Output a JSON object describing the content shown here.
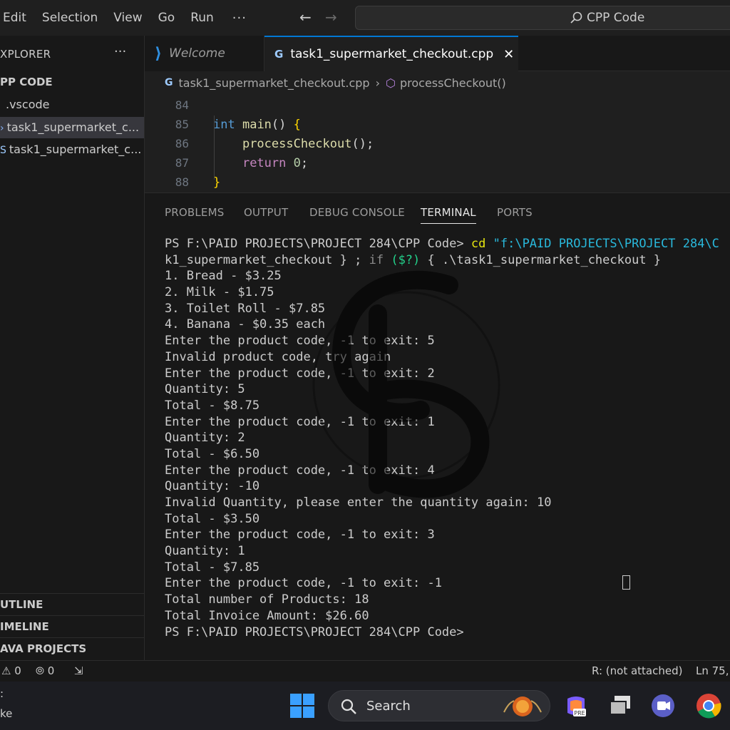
{
  "menubar": {
    "items": [
      "Edit",
      "Selection",
      "View",
      "Go",
      "Run"
    ],
    "more": "···",
    "search_placeholder": "CPP Code"
  },
  "sidebar": {
    "explorer_title": "XPLORER",
    "explorer_more": "···",
    "folder_title": "PP CODE",
    "items": [
      {
        "label": ".vscode"
      },
      {
        "label": "task1_supermarket_c...",
        "prefix": "›"
      },
      {
        "label": "task1_supermarket_c...",
        "prefix": "S"
      }
    ],
    "sections": [
      "UTLINE",
      "IMELINE",
      "AVA PROJECTS"
    ]
  },
  "tabs": {
    "welcome": "Welcome",
    "active": "task1_supermarket_checkout.cpp",
    "close": "✕"
  },
  "breadcrumb": {
    "file": "task1_supermarket_checkout.cpp",
    "symbol": "processCheckout()"
  },
  "editor": {
    "line_numbers": [
      "84",
      "85",
      "86",
      "87",
      "88"
    ],
    "lines": [
      "",
      "int main() {",
      "    processCheckout();",
      "    return 0;",
      "}"
    ]
  },
  "panel": {
    "tabs": [
      "PROBLEMS",
      "OUTPUT",
      "DEBUG CONSOLE",
      "TERMINAL",
      "PORTS"
    ],
    "active_tab": "TERMINAL"
  },
  "terminal": {
    "prompt": "PS F:\\PAID PROJECTS\\PROJECT 284\\CPP Code>",
    "command_cd": "cd",
    "command_path": "\"f:\\PAID PROJECTS\\PROJECT 284\\C",
    "line2_a": "k1_supermarket_checkout } ;",
    "line2_if": "if",
    "line2_cond": "($?)",
    "line2_b": "{ .\\task1_supermarket_checkout }",
    "output": [
      "1. Bread - $3.25",
      "2. Milk - $1.75",
      "3. Toilet Roll - $7.85",
      "4. Banana - $0.35 each",
      "Enter the product code, -1 to exit: 5",
      "Invalid product code, try again",
      "Enter the product code, -1 to exit: 2",
      "Quantity: 5",
      "Total - $8.75",
      "Enter the product code, -1 to exit: 1",
      "Quantity: 2",
      "Total - $6.50",
      "Enter the product code, -1 to exit: 4",
      "Quantity: -10",
      "Invalid Quantity, please enter the quantity again: 10",
      "Total - $3.50",
      "Enter the product code, -1 to exit: 3",
      "Quantity: 1",
      "Total - $7.85",
      "Enter the product code, -1 to exit: -1",
      "Total number of Products: 18",
      "Total Invoice Amount: $26.60"
    ],
    "final_prompt": "PS F:\\PAID PROJECTS\\PROJECT 284\\CPP Code>"
  },
  "statusbar": {
    "errors": "0",
    "warnings": "0",
    "remote": "R: (not attached)",
    "position": "Ln 75,"
  },
  "taskbar": {
    "left_line1": ":",
    "left_line2": "ke",
    "search_label": "Search"
  },
  "colors": {
    "accent": "#0078d4",
    "background": "#181818",
    "editor": "#1f1f1f"
  }
}
